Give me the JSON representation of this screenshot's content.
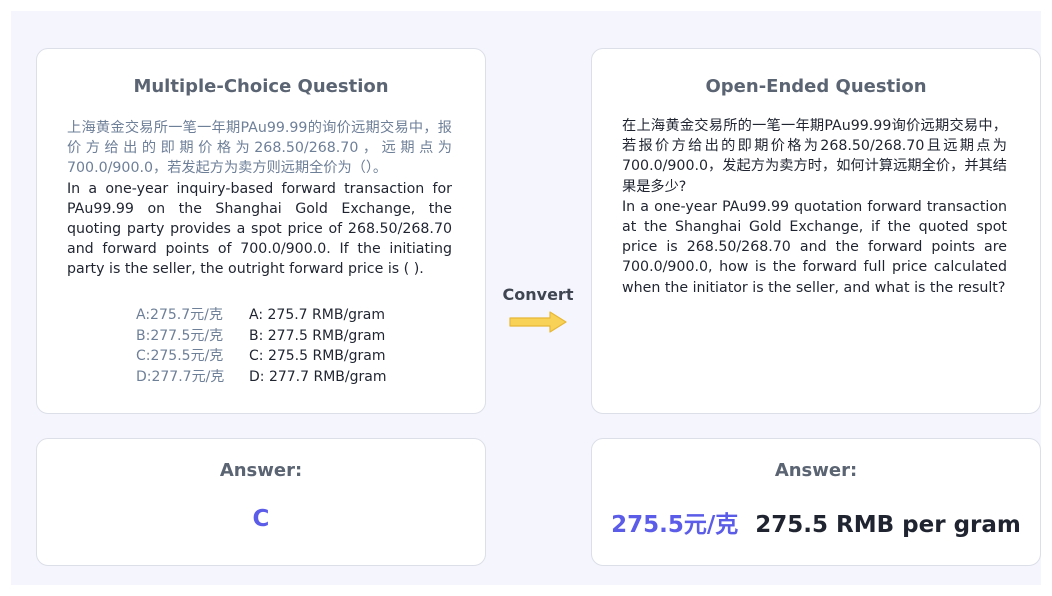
{
  "colors": {
    "accent": "#5b5ce8",
    "arrow": "#f7d257",
    "canvas": "#f5f6fd"
  },
  "mcq": {
    "title": "Multiple-Choice Question",
    "question_cn": "上海黄金交易所一笔一年期PAu99.99的询价远期交易中，报价方给出的即期价格为268.50/268.70，远期点为700.0/900.0，若发起方为卖方则远期全价为（）。",
    "question_en": "In a one-year inquiry-based forward transaction for PAu99.99 on the Shanghai Gold Exchange, the quoting party provides a spot price of 268.50/268.70 and forward points of 700.0/900.0. If the initiating party is the seller, the outright forward price is ( ).",
    "options": [
      {
        "cn": "A:275.7元/克",
        "en": "A: 275.7 RMB/gram"
      },
      {
        "cn": "B:277.5元/克",
        "en": "B: 277.5 RMB/gram"
      },
      {
        "cn": "C:275.5元/克",
        "en": "C: 275.5 RMB/gram"
      },
      {
        "cn": "D:277.7元/克",
        "en": "D: 277.7 RMB/gram"
      }
    ],
    "answer_label": "Answer:",
    "answer_value": "C"
  },
  "convert_label": "Convert",
  "open": {
    "title": "Open-Ended Question",
    "question_cn": "在上海黄金交易所的一笔一年期PAu99.99询价远期交易中，若报价方给出的即期价格为268.50/268.70且远期点为700.0/900.0，发起方为卖方时，如何计算远期全价，并其结果是多少?",
    "question_en": "In a one-year PAu99.99 quotation forward transaction at the Shanghai Gold Exchange, if the quoted spot price is 268.50/268.70 and the forward points are 700.0/900.0, how is the forward full price calculated when the initiator is the seller, and what is the result?",
    "answer_label": "Answer:",
    "answer_cn": "275.5元/克",
    "answer_en": "275.5 RMB per gram"
  }
}
